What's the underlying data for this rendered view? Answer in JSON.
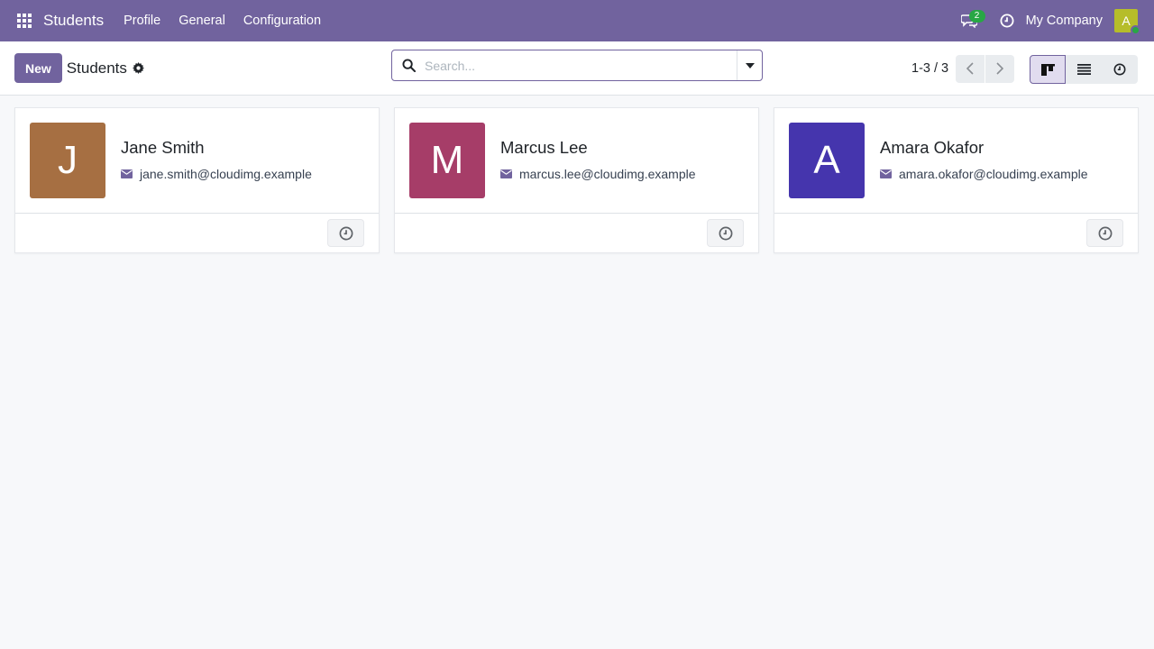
{
  "navbar": {
    "app_name": "Students",
    "menu": [
      "Profile",
      "General",
      "Configuration"
    ],
    "messages_count": "2",
    "company": "My Company",
    "user_initial": "A",
    "user_avatar_color": "#b6bd2a",
    "bg_color": "#71639e"
  },
  "control": {
    "new_label": "New",
    "breadcrumb": "Students",
    "search_placeholder": "Search...",
    "pager": "1-3 / 3",
    "views": [
      "kanban",
      "list",
      "activity"
    ],
    "active_view": "kanban"
  },
  "cards": [
    {
      "initial": "J",
      "name": "Jane Smith",
      "email": "jane.smith@cloudimg.example",
      "color": "#a66f42"
    },
    {
      "initial": "M",
      "name": "Marcus Lee",
      "email": "marcus.lee@cloudimg.example",
      "color": "#a63d68"
    },
    {
      "initial": "A",
      "name": "Amara Okafor",
      "email": "amara.okafor@cloudimg.example",
      "color": "#4535ad"
    }
  ]
}
